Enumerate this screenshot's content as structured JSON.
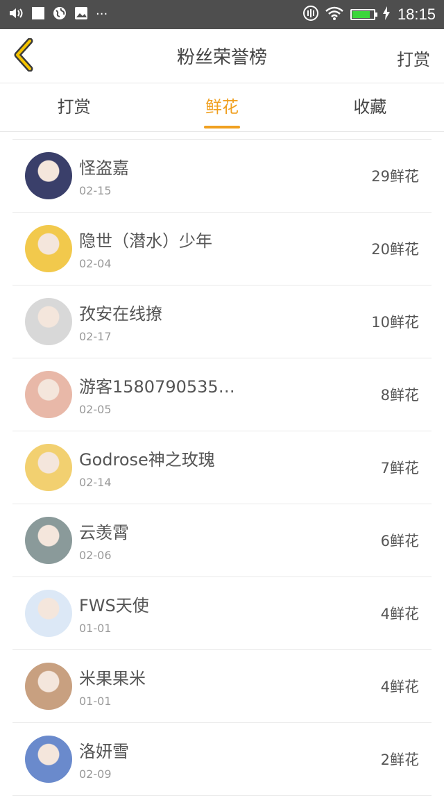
{
  "status_bar": {
    "left_icons": [
      "volume-icon",
      "square-icon",
      "globe-icon",
      "image-icon",
      "more-icon"
    ],
    "right_icons": [
      "vibrate-icon",
      "wifi-icon",
      "battery-icon",
      "charging-icon"
    ],
    "battery_level": 0.85,
    "time": "18:15"
  },
  "header": {
    "title": "粉丝荣誉榜",
    "right_action": "打赏"
  },
  "tabs": [
    {
      "label": "打赏"
    },
    {
      "label": "鲜花"
    },
    {
      "label": "收藏"
    }
  ],
  "active_tab": 1,
  "colors": {
    "accent": "#f0a020",
    "statusbar": "#4e4e4e",
    "battery": "#3bd63b"
  },
  "fans": [
    {
      "name": "怪盗嘉",
      "date": "02-15",
      "count": "29鲜花",
      "avatar_color": "#3a3f6a"
    },
    {
      "name": "隐世（潜水）少年",
      "date": "02-04",
      "count": "20鲜花",
      "avatar_color": "#f2c94c"
    },
    {
      "name": "孜安在线撩",
      "date": "02-17",
      "count": "10鲜花",
      "avatar_color": "#d8d8d8"
    },
    {
      "name": "游客1580790535…",
      "date": "02-05",
      "count": "8鲜花",
      "avatar_color": "#e8b8a8"
    },
    {
      "name": "Godrose神之玫瑰",
      "date": "02-14",
      "count": "7鲜花",
      "avatar_color": "#f2d070"
    },
    {
      "name": "云羡霄",
      "date": "02-06",
      "count": "6鲜花",
      "avatar_color": "#8a9a9a"
    },
    {
      "name": "FWS天使",
      "date": "01-01",
      "count": "4鲜花",
      "avatar_color": "#dce8f6"
    },
    {
      "name": "米果果米",
      "date": "01-01",
      "count": "4鲜花",
      "avatar_color": "#c8a080"
    },
    {
      "name": "洛妍雪",
      "date": "02-09",
      "count": "2鲜花",
      "avatar_color": "#6a8acc"
    }
  ]
}
